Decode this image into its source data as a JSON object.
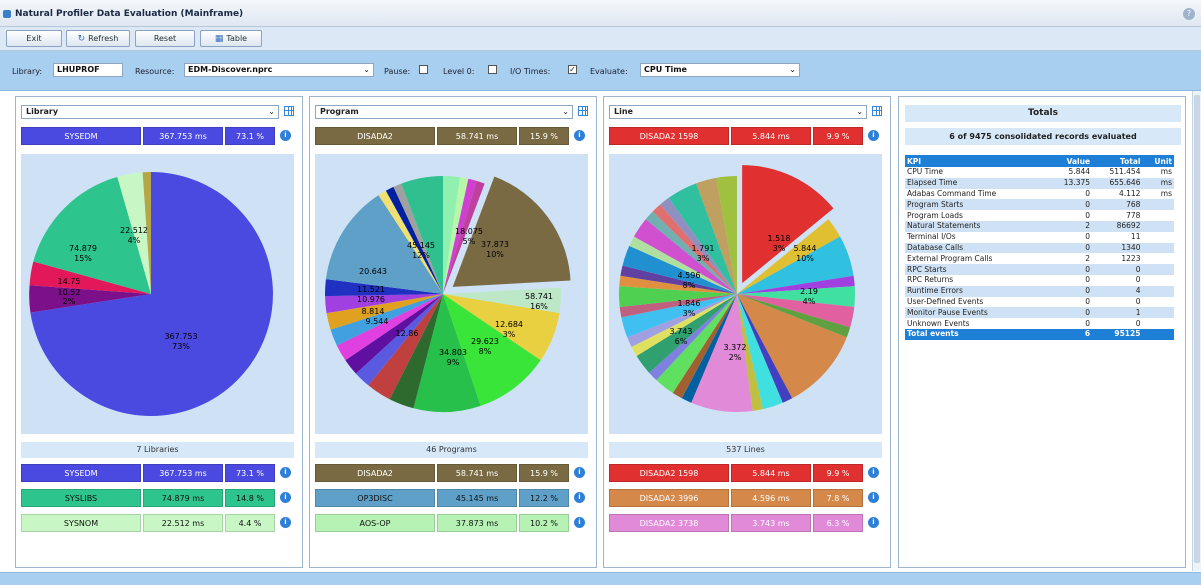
{
  "window": {
    "title": "Natural Profiler Data Evaluation (Mainframe)",
    "help_label": "? ×"
  },
  "toolbar": {
    "exit": "Exit",
    "refresh": "Refresh",
    "reset": "Reset",
    "table": "Table"
  },
  "filters": {
    "library_label": "Library:",
    "library_value": "LHUPROF",
    "resource_label": "Resource:",
    "resource_value": "EDM-Discover.nprc",
    "pause_label": "Pause:",
    "pause_checked": false,
    "level0_label": "Level 0:",
    "level0_checked": false,
    "io_label": "I/O Times:",
    "io_checked": true,
    "evaluate_label": "Evaluate:",
    "evaluate_value": "CPU Time"
  },
  "panels": [
    {
      "select": "Library",
      "top": {
        "name": "SYSEDM",
        "value": "367.753 ms",
        "pct": "73.1 %",
        "color": "#4a4ae0"
      },
      "count": "7 Libraries",
      "list": [
        {
          "name": "SYSEDM",
          "value": "367.753 ms",
          "pct": "73.1 %",
          "color": "#4a4ae0"
        },
        {
          "name": "SYSLIBS",
          "value": "74.879 ms",
          "pct": "14.8 %",
          "color": "#2ec48e"
        },
        {
          "name": "SYSNOM",
          "value": "22.512 ms",
          "pct": "4.4 %",
          "color": "#c8f7c5"
        }
      ]
    },
    {
      "select": "Program",
      "top": {
        "name": "DISADA2",
        "value": "58.741 ms",
        "pct": "15.9 %",
        "color": "#7a6a44"
      },
      "count": "46 Programs",
      "list": [
        {
          "name": "DISADA2",
          "value": "58.741 ms",
          "pct": "15.9 %",
          "color": "#7a6a44"
        },
        {
          "name": "OP3DISC",
          "value": "45.145 ms",
          "pct": "12.2 %",
          "color": "#5fa0c8"
        },
        {
          "name": "AOS-OP",
          "value": "37.873 ms",
          "pct": "10.2 %",
          "color": "#b6f2b4"
        }
      ]
    },
    {
      "select": "Line",
      "top": {
        "name": "DISADA2 1598",
        "value": "5.844 ms",
        "pct": "9.9 %",
        "color": "#e03030"
      },
      "count": "537 Lines",
      "list": [
        {
          "name": "DISADA2 1598",
          "value": "5.844 ms",
          "pct": "9.9 %",
          "color": "#e03030"
        },
        {
          "name": "DISADA2 3996",
          "value": "4.596 ms",
          "pct": "7.8 %",
          "color": "#d4884a"
        },
        {
          "name": "DISADA2 3738",
          "value": "3.743 ms",
          "pct": "6.3 %",
          "color": "#e08ad8"
        }
      ]
    }
  ],
  "pie_labels": {
    "library": [
      {
        "value": "367.753",
        "pct": "73%"
      },
      {
        "value": "74.879",
        "pct": "15%"
      },
      {
        "value": "22.512",
        "pct": "4%"
      },
      {
        "value": "14.75",
        "pct": ""
      },
      {
        "value": "10.52",
        "pct": "2%"
      }
    ],
    "program": [
      {
        "value": "58.741",
        "pct": "16%"
      },
      {
        "value": "45.145",
        "pct": "12%"
      },
      {
        "value": "37.873",
        "pct": "10%"
      },
      {
        "value": "34.803",
        "pct": "9%"
      },
      {
        "value": "29.623",
        "pct": "8%"
      },
      {
        "value": "18.075",
        "pct": "5%"
      },
      {
        "value": "12.684",
        "pct": "3%"
      },
      {
        "value": "20.643",
        "pct": ""
      },
      {
        "value": "11.521",
        "pct": ""
      },
      {
        "value": "10.976",
        "pct": ""
      },
      {
        "value": "9.544",
        "pct": ""
      },
      {
        "value": "8.814",
        "pct": ""
      },
      {
        "value": "12.86",
        "pct": ""
      }
    ],
    "line": [
      {
        "value": "5.844",
        "pct": "10%"
      },
      {
        "value": "4.596",
        "pct": "8%"
      },
      {
        "value": "3.743",
        "pct": "6%"
      },
      {
        "value": "3.372",
        "pct": "2%"
      },
      {
        "value": "1.791",
        "pct": "3%"
      },
      {
        "value": "1.846",
        "pct": "3%"
      },
      {
        "value": "1.518",
        "pct": "3%"
      },
      {
        "value": "2.19",
        "pct": "4%"
      }
    ]
  },
  "totals": {
    "title": "Totals",
    "subtitle": "6 of 9475 consolidated records evaluated",
    "headers": [
      "KPI",
      "Value",
      "Total",
      "Unit"
    ],
    "rows": [
      [
        "CPU Time",
        "5.844",
        "511.454",
        "ms"
      ],
      [
        "Elapsed Time",
        "13.375",
        "655.646",
        "ms"
      ],
      [
        "Adabas Command Time",
        "0",
        "4.112",
        "ms"
      ],
      [
        "Program Starts",
        "0",
        "768",
        ""
      ],
      [
        "Program Loads",
        "0",
        "778",
        ""
      ],
      [
        "Natural Statements",
        "2",
        "86692",
        ""
      ],
      [
        "Terminal I/Os",
        "0",
        "11",
        ""
      ],
      [
        "Database Calls",
        "0",
        "1340",
        ""
      ],
      [
        "External Program Calls",
        "2",
        "1223",
        ""
      ],
      [
        "RPC Starts",
        "0",
        "0",
        ""
      ],
      [
        "RPC Returns",
        "0",
        "0",
        ""
      ],
      [
        "Runtime Errors",
        "0",
        "4",
        ""
      ],
      [
        "User-Defined Events",
        "0",
        "0",
        ""
      ],
      [
        "Monitor Pause Events",
        "0",
        "1",
        ""
      ],
      [
        "Unknown Events",
        "0",
        "0",
        ""
      ]
    ],
    "total_row": [
      "Total events",
      "6",
      "95125",
      ""
    ]
  }
}
